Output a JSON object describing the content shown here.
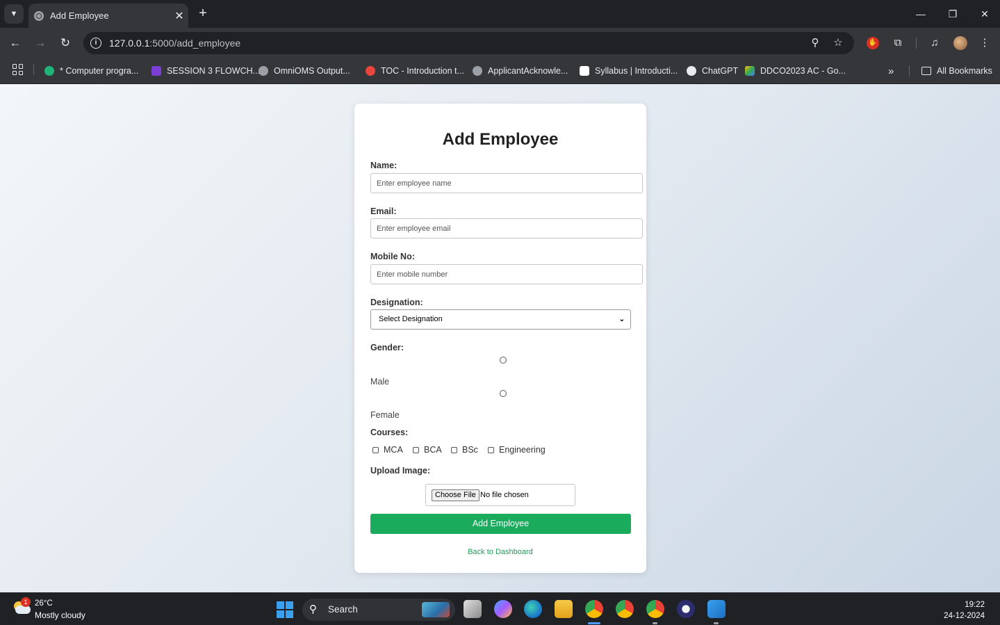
{
  "browser": {
    "tab_title": "Add Employee",
    "tab_close": "✕",
    "new_tab": "+",
    "url_host": "127.0.0.1",
    "url_path": ":5000/add_employee",
    "window_controls": {
      "minimize": "—",
      "restore": "❐",
      "close": "✕"
    },
    "bookmarks": [
      {
        "label": "* Computer progra..."
      },
      {
        "label": "SESSION 3 FLOWCH..."
      },
      {
        "label": "OmniOMS Output..."
      },
      {
        "label": "TOC - Introduction t..."
      },
      {
        "label": "ApplicantAcknowle..."
      },
      {
        "label": "Syllabus | Introducti..."
      },
      {
        "label": "ChatGPT"
      },
      {
        "label": "DDCO2023 AC - Go..."
      }
    ],
    "more_bookmarks": "»",
    "all_bookmarks": "All Bookmarks"
  },
  "form": {
    "heading": "Add Employee",
    "name_label": "Name:",
    "name_placeholder": "Enter employee name",
    "email_label": "Email:",
    "email_placeholder": "Enter employee email",
    "mobile_label": "Mobile No:",
    "mobile_placeholder": "Enter mobile number",
    "designation_label": "Designation:",
    "designation_selected": "Select Designation",
    "gender_label": "Gender:",
    "gender_options": [
      "Male",
      "Female"
    ],
    "courses_label": "Courses:",
    "courses": [
      "MCA",
      "BCA",
      "BSc",
      "Engineering"
    ],
    "upload_label": "Upload Image:",
    "file_button": "Choose File",
    "file_status": "No file chosen",
    "submit_label": "Add Employee",
    "back_link": "Back to Dashboard"
  },
  "taskbar": {
    "weather_badge": "1",
    "temperature": "26°C",
    "condition": "Mostly cloudy",
    "search_label": "Search",
    "time": "19:22",
    "date": "24-12-2024"
  },
  "colors": {
    "submit_green": "#1aab5c",
    "link_green": "#1a9e55",
    "chrome_dark": "#202124",
    "chrome_toolbar": "#35363a"
  }
}
